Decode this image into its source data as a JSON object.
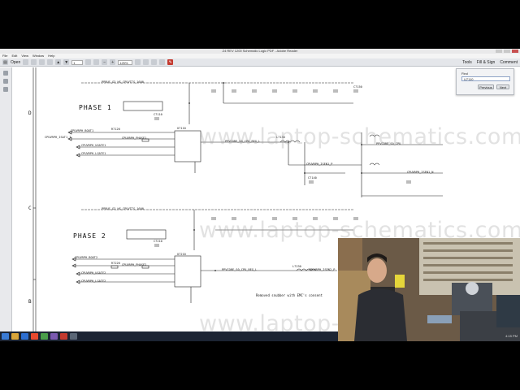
{
  "window": {
    "title": "Z4 REV 1200 Schematic Logic PDF - Adobe Reader"
  },
  "menu": [
    "File",
    "Edit",
    "View",
    "Window",
    "Help"
  ],
  "toolbar": {
    "open_label": "Open",
    "page_current": "1",
    "zoom": "125%"
  },
  "right_tools": {
    "tools": "Tools",
    "fill_sign": "Fill & Sign",
    "comment": "Comment"
  },
  "find": {
    "label": "Find",
    "value": "U7110",
    "previous": "Previous",
    "next": "Next"
  },
  "schematic": {
    "phase1": "PHASE 1",
    "phase2": "PHASE 2",
    "row_labels": [
      "D",
      "C",
      "B"
    ],
    "watermark": "www.laptop-schematics.com",
    "top_rail_1": "PPBUS_G3_HS_CPUVTTS_1600",
    "top_rail_2": "PPBUS_G3_HS_CPUVTTS_1600",
    "note_bottom": "Removed snubber with EMC's consent",
    "nets": [
      "CPUVRPH_BOOT1",
      "CPUVRPH_ISAT1_I",
      "CPUVRPH_UGATE1",
      "CPUVRPH_PHASE1",
      "CPUVRPH_LGATE1",
      "PPVCORE_S0_CPU_REG_L",
      "PPVCORE_S0_CPU",
      "CPUVRPH_ISEN1_P",
      "CPUVRPH_ISEN1_N",
      "CPUVRPH_BOOT2",
      "CPUVRPH_UGATE2",
      "CPUVRPH_PHASE2",
      "CPUVRPH_LGATE2",
      "PPVCORE_S0_CPU_REG_L",
      "CPUVRPH_ISEN2_P"
    ],
    "refdes": [
      "U7110",
      "R7120",
      "C7110",
      "L7130",
      "C7140",
      "C7150",
      "U7210",
      "L7230",
      "R7220",
      "C7210"
    ]
  },
  "taskbar": {
    "time": "4:15 PM"
  }
}
